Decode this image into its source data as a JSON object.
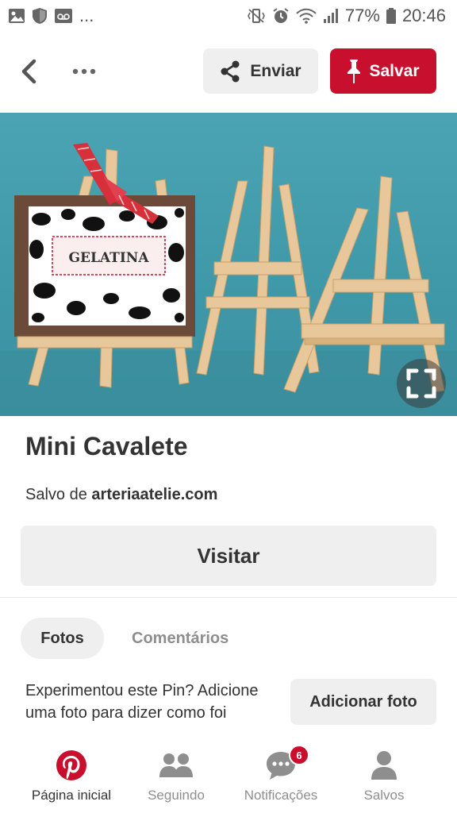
{
  "status_bar": {
    "battery": "77%",
    "time": "20:46",
    "notifications_more": "..."
  },
  "top_bar": {
    "share_label": "Enviar",
    "save_label": "Salvar"
  },
  "pin": {
    "image_card_text": "GELATINA",
    "title": "Mini Cavalete",
    "saved_from_prefix": "Salvo de",
    "source": "arteriaatelie.com",
    "visit_label": "Visitar"
  },
  "tabs": [
    {
      "label": "Fotos",
      "active": true
    },
    {
      "label": "Comentários",
      "active": false
    }
  ],
  "try_pin": {
    "text": "Experimentou este Pin? Adicione uma foto para dizer como foi",
    "button_label": "Adicionar foto"
  },
  "bottom_nav": {
    "items": [
      {
        "label": "Página inicial",
        "icon": "pinterest-logo-icon",
        "active": true
      },
      {
        "label": "Seguindo",
        "icon": "people-icon",
        "active": false
      },
      {
        "label": "Notificações",
        "icon": "chat-bubble-icon",
        "active": false,
        "badge": "6"
      },
      {
        "label": "Salvos",
        "icon": "person-icon",
        "active": false
      }
    ]
  },
  "colors": {
    "brand_red": "#c8102e",
    "button_gray": "#efefef",
    "text_dark": "#333333",
    "text_muted": "#8e8e8e",
    "image_background": "#4aa4b3"
  }
}
